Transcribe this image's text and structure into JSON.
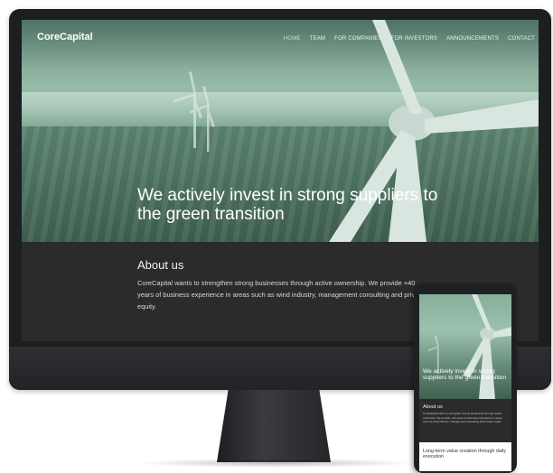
{
  "brand": {
    "name": "CoreCapital"
  },
  "nav": {
    "items": [
      {
        "label": "HOME",
        "active": true
      },
      {
        "label": "TEAM",
        "active": false
      },
      {
        "label": "FOR COMPANIES",
        "active": false
      },
      {
        "label": "FOR INVESTORS",
        "active": false
      },
      {
        "label": "ANNOUNCEMENTS",
        "active": false
      },
      {
        "label": "CONTACT",
        "active": false
      }
    ]
  },
  "hero": {
    "title": "We actively invest in strong suppliers to the green transition"
  },
  "about": {
    "heading": "About us",
    "text": "CoreCapital wants to strengthen strong businesses through active ownership. We provide +40 years of business experience in areas such as wind industry, management consulting and private equity."
  },
  "phone": {
    "hero_title": "We actively invest in strong suppliers to the green transition",
    "about_heading": "About us",
    "about_text": "CoreCapital wants to strengthen strong businesses through active ownership. We provide +40 years of business experience in areas such as wind industry, management consulting and private equity.",
    "tagline": "Long-term value creation through daily execution"
  },
  "colors": {
    "hero_green": "#7fa896",
    "dark_section": "#2b2b2b",
    "device_frame": "#1d1e20",
    "active_nav": "#bfe3cf"
  }
}
